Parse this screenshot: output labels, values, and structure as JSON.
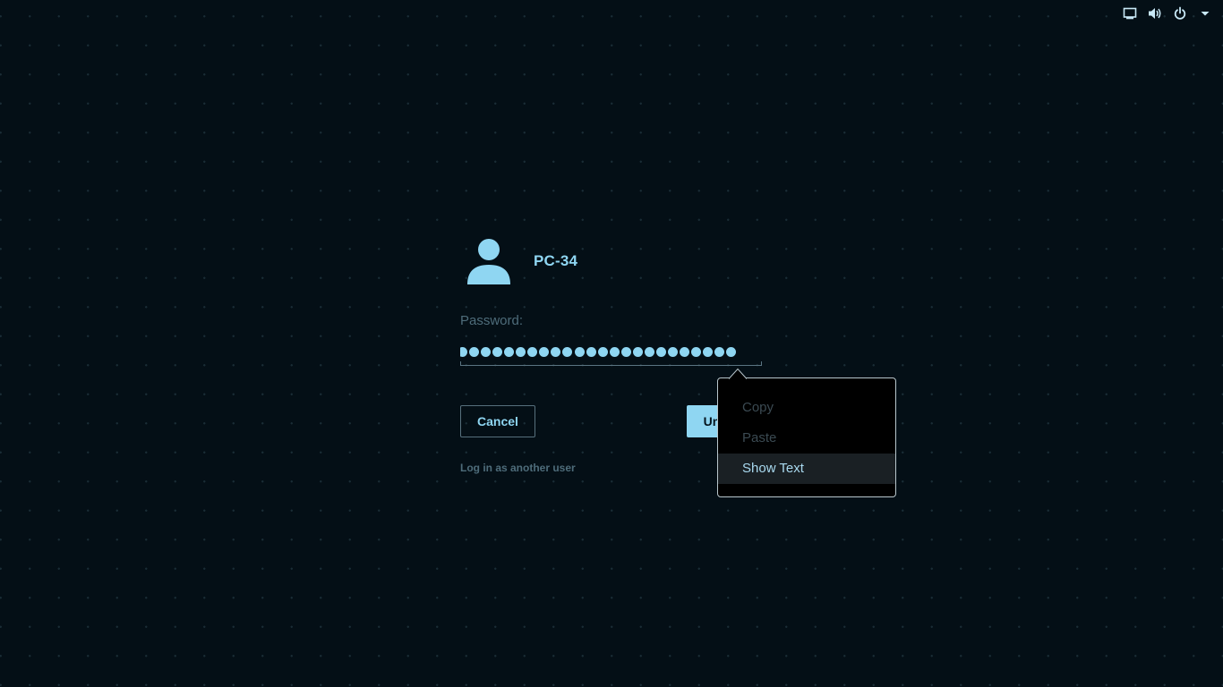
{
  "topbar": {
    "icons": [
      "display-icon",
      "volume-icon",
      "power-icon",
      "dropdown-arrow-icon"
    ]
  },
  "user": {
    "name": "PC-34",
    "avatar_icon": "user-avatar-icon"
  },
  "password": {
    "label": "Password:",
    "masked_char_count": 24
  },
  "buttons": {
    "cancel": "Cancel",
    "unlock": "Unlock"
  },
  "other_user_link": "Log in as another user",
  "context_menu": {
    "items": [
      {
        "label": "Copy",
        "enabled": false
      },
      {
        "label": "Paste",
        "enabled": false
      },
      {
        "label": "Show Text",
        "enabled": true,
        "highlighted": true
      }
    ]
  },
  "colors": {
    "background": "#040f16",
    "accent": "#8fd6f2",
    "muted_text": "#4e6c7a",
    "menu_background": "#000000",
    "menu_highlight": "#1a2024"
  }
}
